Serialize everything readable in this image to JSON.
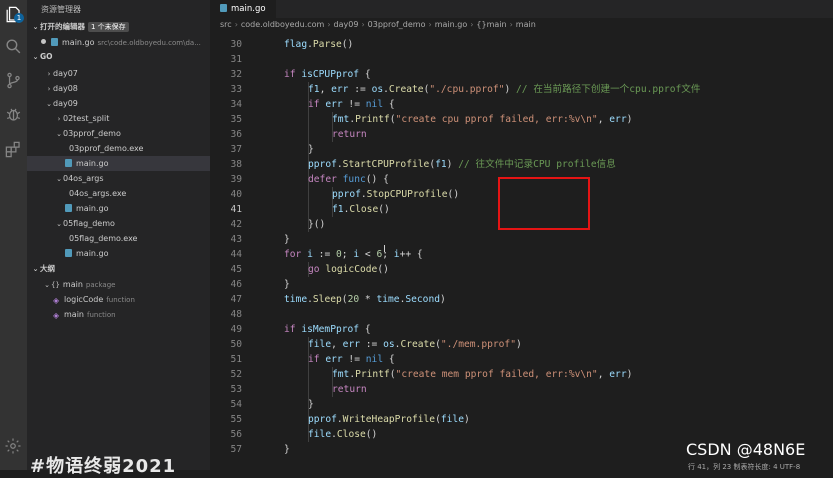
{
  "sidebar": {
    "title": "资源管理器",
    "open_editors": {
      "label": "打开的编辑器",
      "unsaved": "1 个未保存",
      "file": "main.go",
      "path": "src\\code.oldboyedu.com\\da..."
    },
    "project_label": "GO",
    "tree": [
      {
        "label": "day07",
        "type": "folder",
        "open": false,
        "depth": 1
      },
      {
        "label": "day08",
        "type": "folder",
        "open": false,
        "depth": 1
      },
      {
        "label": "day09",
        "type": "folder",
        "open": true,
        "depth": 1
      },
      {
        "label": "02test_split",
        "type": "folder",
        "open": false,
        "depth": 2
      },
      {
        "label": "03pprof_demo",
        "type": "folder",
        "open": true,
        "depth": 2
      },
      {
        "label": "03pprof_demo.exe",
        "type": "file",
        "depth": 3
      },
      {
        "label": "main.go",
        "type": "go",
        "depth": 3,
        "selected": true
      },
      {
        "label": "04os_args",
        "type": "folder",
        "open": true,
        "depth": 2
      },
      {
        "label": "04os_args.exe",
        "type": "file",
        "depth": 3
      },
      {
        "label": "main.go",
        "type": "go",
        "depth": 3
      },
      {
        "label": "05flag_demo",
        "type": "folder",
        "open": true,
        "depth": 2
      },
      {
        "label": "05flag_demo.exe",
        "type": "file",
        "depth": 3
      },
      {
        "label": "main.go",
        "type": "go",
        "depth": 3
      }
    ],
    "outline_label": "大纲",
    "outline": [
      {
        "label": "main",
        "kind": "package",
        "icon": "package-icon",
        "depth": 1
      },
      {
        "label": "logicCode",
        "kind": "function",
        "icon": "function-icon",
        "depth": 2
      },
      {
        "label": "main",
        "kind": "function",
        "icon": "function-icon",
        "depth": 2
      }
    ]
  },
  "tab": {
    "label": "main.go"
  },
  "breadcrumb": [
    "src",
    "code.oldboyedu.com",
    "day09",
    "03pprof_demo",
    "main.go",
    "{}main",
    "main"
  ],
  "editor": {
    "current_line": 41,
    "lines": [
      {
        "n": 30,
        "indent": 1,
        "tokens": [
          [
            "v",
            "flag"
          ],
          [
            "p",
            "."
          ],
          [
            "f",
            "Parse"
          ],
          [
            "p",
            "()"
          ]
        ]
      },
      {
        "n": 31,
        "indent": 0,
        "tokens": []
      },
      {
        "n": 32,
        "indent": 1,
        "tokens": [
          [
            "c",
            "if "
          ],
          [
            "v",
            "isCPUPprof"
          ],
          [
            "p",
            " {"
          ]
        ]
      },
      {
        "n": 33,
        "indent": 2,
        "tokens": [
          [
            "v",
            "f1"
          ],
          [
            "p",
            ", "
          ],
          [
            "v",
            "err"
          ],
          [
            "p",
            " := "
          ],
          [
            "v",
            "os"
          ],
          [
            "p",
            "."
          ],
          [
            "f",
            "Create"
          ],
          [
            "p",
            "("
          ],
          [
            "s",
            "\"./cpu.pprof\""
          ],
          [
            "p",
            ") "
          ],
          [
            "cm",
            "// 在当前路径下创建一个cpu.pprof文件"
          ]
        ]
      },
      {
        "n": 34,
        "indent": 2,
        "tokens": [
          [
            "c",
            "if "
          ],
          [
            "v",
            "err"
          ],
          [
            "p",
            " != "
          ],
          [
            "k",
            "nil"
          ],
          [
            "p",
            " {"
          ]
        ]
      },
      {
        "n": 35,
        "indent": 3,
        "tokens": [
          [
            "v",
            "fmt"
          ],
          [
            "p",
            "."
          ],
          [
            "f",
            "Printf"
          ],
          [
            "p",
            "("
          ],
          [
            "s",
            "\"create cpu pprof failed, err:%v\\n\""
          ],
          [
            "p",
            ", "
          ],
          [
            "v",
            "err"
          ],
          [
            "p",
            ")"
          ]
        ]
      },
      {
        "n": 36,
        "indent": 3,
        "tokens": [
          [
            "c",
            "return"
          ]
        ]
      },
      {
        "n": 37,
        "indent": 2,
        "tokens": [
          [
            "p",
            "}"
          ]
        ]
      },
      {
        "n": 38,
        "indent": 2,
        "tokens": [
          [
            "v",
            "pprof"
          ],
          [
            "p",
            "."
          ],
          [
            "f",
            "StartCPUProfile"
          ],
          [
            "p",
            "("
          ],
          [
            "v",
            "f1"
          ],
          [
            "p",
            ") "
          ],
          [
            "cm",
            "// 往文件中记录CPU profile信息"
          ]
        ]
      },
      {
        "n": 39,
        "indent": 2,
        "tokens": [
          [
            "c",
            "defer "
          ],
          [
            "k",
            "func"
          ],
          [
            "p",
            "() {"
          ]
        ]
      },
      {
        "n": 40,
        "indent": 3,
        "tokens": [
          [
            "v",
            "pprof"
          ],
          [
            "p",
            "."
          ],
          [
            "f",
            "StopCPUProfile"
          ],
          [
            "p",
            "()"
          ]
        ]
      },
      {
        "n": 41,
        "indent": 3,
        "tokens": [
          [
            "v",
            "f1"
          ],
          [
            "p",
            "."
          ],
          [
            "f",
            "Close"
          ],
          [
            "p",
            "()"
          ]
        ]
      },
      {
        "n": 42,
        "indent": 2,
        "tokens": [
          [
            "p",
            "}()"
          ]
        ]
      },
      {
        "n": 43,
        "indent": 1,
        "tokens": [
          [
            "p",
            "}"
          ]
        ]
      },
      {
        "n": 44,
        "indent": 1,
        "tokens": [
          [
            "c",
            "for "
          ],
          [
            "v",
            "i"
          ],
          [
            "p",
            " := "
          ],
          [
            "n",
            "0"
          ],
          [
            "p",
            "; "
          ],
          [
            "v",
            "i"
          ],
          [
            "p",
            " < "
          ],
          [
            "n",
            "6"
          ],
          [
            "p",
            "; "
          ],
          [
            "v",
            "i"
          ],
          [
            "p",
            "++ {"
          ]
        ]
      },
      {
        "n": 45,
        "indent": 2,
        "tokens": [
          [
            "c",
            "go "
          ],
          [
            "f",
            "logicCode"
          ],
          [
            "p",
            "()"
          ]
        ]
      },
      {
        "n": 46,
        "indent": 1,
        "tokens": [
          [
            "p",
            "}"
          ]
        ]
      },
      {
        "n": 47,
        "indent": 1,
        "tokens": [
          [
            "v",
            "time"
          ],
          [
            "p",
            "."
          ],
          [
            "f",
            "Sleep"
          ],
          [
            "p",
            "("
          ],
          [
            "n",
            "20"
          ],
          [
            "p",
            " * "
          ],
          [
            "v",
            "time"
          ],
          [
            "p",
            "."
          ],
          [
            "v",
            "Second"
          ],
          [
            "p",
            ")"
          ]
        ]
      },
      {
        "n": 48,
        "indent": 0,
        "tokens": []
      },
      {
        "n": 49,
        "indent": 1,
        "tokens": [
          [
            "c",
            "if "
          ],
          [
            "v",
            "isMemPprof"
          ],
          [
            "p",
            " {"
          ]
        ]
      },
      {
        "n": 50,
        "indent": 2,
        "tokens": [
          [
            "v",
            "file"
          ],
          [
            "p",
            ", "
          ],
          [
            "v",
            "err"
          ],
          [
            "p",
            " := "
          ],
          [
            "v",
            "os"
          ],
          [
            "p",
            "."
          ],
          [
            "f",
            "Create"
          ],
          [
            "p",
            "("
          ],
          [
            "s",
            "\"./mem.pprof\""
          ],
          [
            "p",
            ")"
          ]
        ]
      },
      {
        "n": 51,
        "indent": 2,
        "tokens": [
          [
            "c",
            "if "
          ],
          [
            "v",
            "err"
          ],
          [
            "p",
            " != "
          ],
          [
            "k",
            "nil"
          ],
          [
            "p",
            " {"
          ]
        ]
      },
      {
        "n": 52,
        "indent": 3,
        "tokens": [
          [
            "v",
            "fmt"
          ],
          [
            "p",
            "."
          ],
          [
            "f",
            "Printf"
          ],
          [
            "p",
            "("
          ],
          [
            "s",
            "\"create mem pprof failed, err:%v\\n\""
          ],
          [
            "p",
            ", "
          ],
          [
            "v",
            "err"
          ],
          [
            "p",
            ")"
          ]
        ]
      },
      {
        "n": 53,
        "indent": 3,
        "tokens": [
          [
            "c",
            "return"
          ]
        ]
      },
      {
        "n": 54,
        "indent": 2,
        "tokens": [
          [
            "p",
            "}"
          ]
        ]
      },
      {
        "n": 55,
        "indent": 2,
        "tokens": [
          [
            "v",
            "pprof"
          ],
          [
            "p",
            "."
          ],
          [
            "f",
            "WriteHeapProfile"
          ],
          [
            "p",
            "("
          ],
          [
            "v",
            "file"
          ],
          [
            "p",
            ")"
          ]
        ]
      },
      {
        "n": 56,
        "indent": 2,
        "tokens": [
          [
            "v",
            "file"
          ],
          [
            "p",
            "."
          ],
          [
            "f",
            "Close"
          ],
          [
            "p",
            "()"
          ]
        ]
      },
      {
        "n": 57,
        "indent": 1,
        "tokens": [
          [
            "p",
            "}"
          ]
        ]
      }
    ]
  },
  "overlays": {
    "watermark": "CSDN @48N6E",
    "bottom_text": "#物语终弱2021",
    "status_hint": "行 41，列 23    制表符长度: 4    UTF-8"
  }
}
